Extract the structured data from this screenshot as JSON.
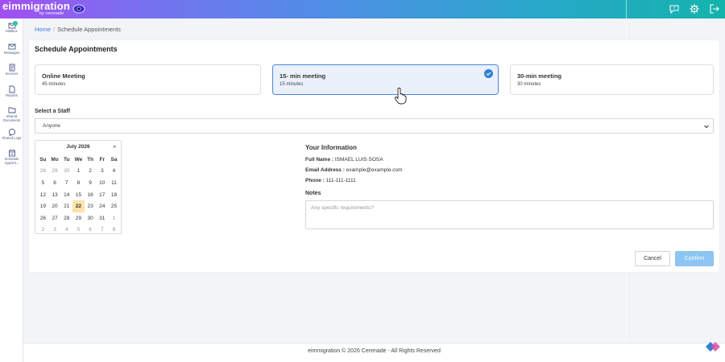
{
  "app": {
    "brand": "eimmigration",
    "brand_sub": "by cerenade"
  },
  "topbar": {
    "icons": [
      "help-icon",
      "settings-icon",
      "logout-icon"
    ]
  },
  "sidebar": {
    "items": [
      {
        "label": "Mailbox",
        "icon": "mailbox-icon"
      },
      {
        "label": "Messages",
        "icon": "messages-icon"
      },
      {
        "label": "Invoices",
        "icon": "invoices-icon"
      },
      {
        "label": "Reports",
        "icon": "reports-icon"
      },
      {
        "label": "Shared Documents",
        "icon": "folder-icon"
      },
      {
        "label": "Shared Logs",
        "icon": "logs-icon"
      },
      {
        "label": "Schedule Appoint...",
        "icon": "calendar-icon"
      }
    ]
  },
  "breadcrumb": {
    "home": "Home",
    "separator": "/",
    "current": "Schedule Appointments"
  },
  "page": {
    "title": "Schedule Appointments"
  },
  "meeting_types": [
    {
      "title": "Online Meeting",
      "duration": "45 minutes",
      "selected": false
    },
    {
      "title": "15- min meeting",
      "duration": "15 minutes",
      "selected": true
    },
    {
      "title": "30-min meeting",
      "duration": "30 minutes",
      "selected": false
    }
  ],
  "staff": {
    "label": "Select a Staff",
    "value": "Anyone"
  },
  "calendar": {
    "month_label": "July 2026",
    "next_label": "»",
    "weekdays": [
      "Su",
      "Mo",
      "Tu",
      "We",
      "Th",
      "Fr",
      "Sa"
    ],
    "weeks": [
      [
        "28",
        "29",
        "30",
        "1",
        "2",
        "3",
        "4"
      ],
      [
        "5",
        "6",
        "7",
        "8",
        "9",
        "10",
        "11"
      ],
      [
        "12",
        "13",
        "14",
        "15",
        "16",
        "17",
        "18"
      ],
      [
        "19",
        "20",
        "21",
        "22",
        "23",
        "24",
        "25"
      ],
      [
        "26",
        "27",
        "28",
        "29",
        "30",
        "31",
        "1"
      ],
      [
        "2",
        "3",
        "4",
        "5",
        "6",
        "7",
        "8"
      ]
    ],
    "selected_day": "22"
  },
  "info": {
    "title": "Your Information",
    "full_name_label": "Full Name :",
    "full_name": "ISMAEL LUIS SOSA",
    "email_label": "Email Address :",
    "email": "example@example.com",
    "phone_label": "Phone :",
    "phone": "111-111-1111"
  },
  "notes": {
    "label": "Notes",
    "placeholder": "Any specific requirements?",
    "value": ""
  },
  "actions": {
    "cancel": "Cancel",
    "confirm": "Confirm"
  },
  "footer": {
    "text": "eimmigration © 2026 Cerenade - All Rights Reserved"
  },
  "colors": {
    "accent": "#2f7fd8",
    "selected_bg": "#eaf1fb",
    "today_bg": "#fce3a8",
    "confirm_bg": "#8cc4f2"
  }
}
